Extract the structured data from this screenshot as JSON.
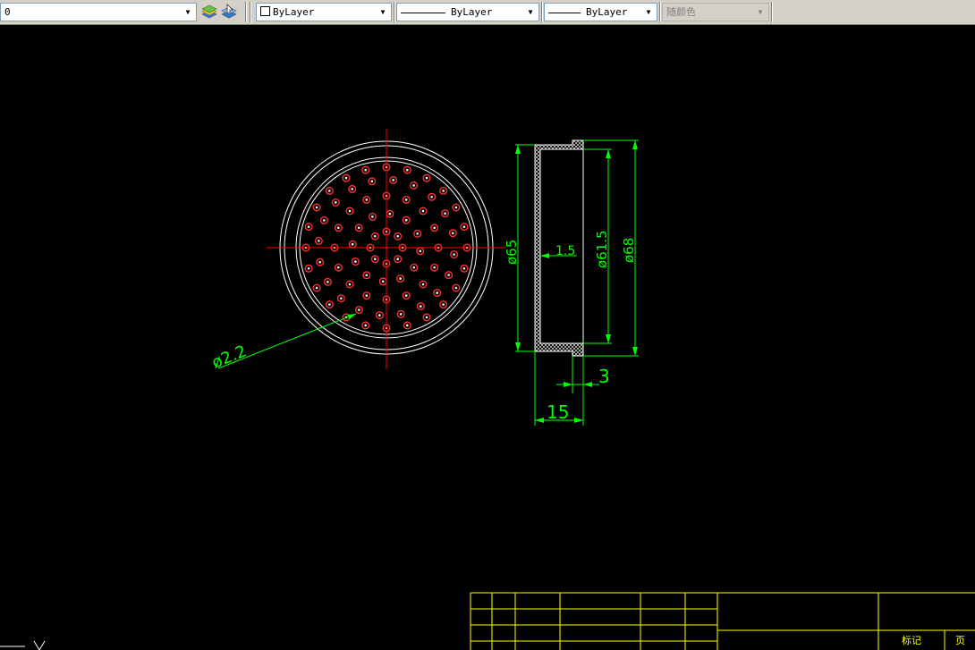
{
  "toolbar": {
    "layer_value": "0",
    "color_value": "ByLayer",
    "linetype_value": "ByLayer",
    "lineweight_value": "ByLayer",
    "plotstyle_value": "随颜色",
    "icons": [
      "layer-states-icon",
      "make-object-layer-current-icon"
    ]
  },
  "colors": {
    "background": "#000000",
    "geometry": "#ffffff",
    "centerline": "#ff0000",
    "dimension": "#00ff00",
    "title_block": "#ffff00"
  },
  "drawing": {
    "hole_count": 96,
    "dimensions": {
      "hole_dia": "ø2.2",
      "inner_dia": "ø65",
      "wall": "1.5",
      "bore_dia": "ø61.5",
      "outer_dia": "ø68",
      "lip": "3",
      "depth": "15"
    }
  },
  "title_block": {
    "cell_mark": "标记",
    "cell_page": "页"
  }
}
